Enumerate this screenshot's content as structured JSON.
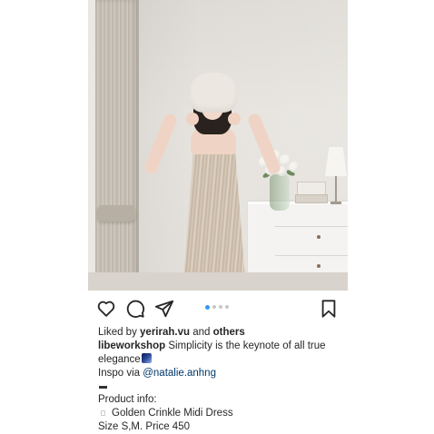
{
  "post": {
    "photo": {
      "alt_name": "fashion-photo"
    },
    "actions": {
      "like_icon": "heart-icon",
      "comment_icon": "comment-icon",
      "share_icon": "share-icon",
      "save_icon": "bookmark-icon",
      "carousel": {
        "total": 4,
        "active": 1
      }
    },
    "likes": {
      "prefix": "Liked by ",
      "user": "yerirah.vu",
      "joiner": " and ",
      "others": "others"
    },
    "caption": {
      "username": "libeworkshop",
      "text_line1": " Simplicity is the keynote of all true",
      "text_line2": "elegance",
      "emoji": "night-sky-emoji",
      "inspo_prefix": "Inspo via ",
      "inspo_handle": "@natalie.anhng",
      "product_heading": "Product info:",
      "product_name": "Golden Crinkle Midi Dress",
      "product_details": "Size S,M. Price 450"
    },
    "colors": {
      "text": "#262626",
      "link": "#00376b",
      "carousel_active": "#3897f0",
      "carousel_inactive": "#c7c7c7"
    }
  }
}
